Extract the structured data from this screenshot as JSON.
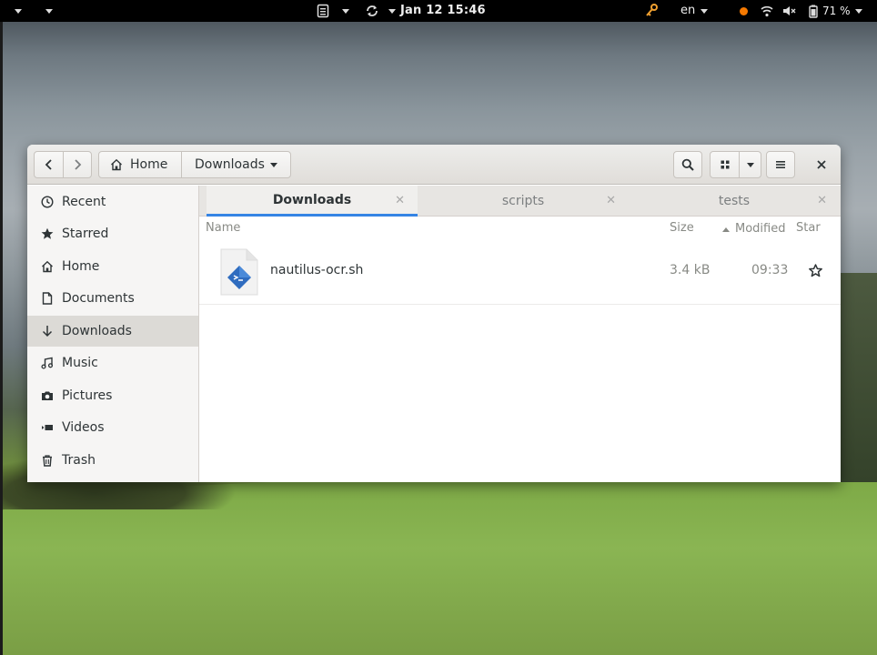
{
  "topbar": {
    "clock": "Jan 12  15:46",
    "language": "en",
    "battery": "71 %"
  },
  "window": {
    "path": {
      "home": "Home",
      "current": "Downloads"
    },
    "sidebar": {
      "items": [
        {
          "label": "Recent",
          "icon": "clock-icon"
        },
        {
          "label": "Starred",
          "icon": "star-icon"
        },
        {
          "label": "Home",
          "icon": "home-icon"
        },
        {
          "label": "Documents",
          "icon": "document-icon"
        },
        {
          "label": "Downloads",
          "icon": "download-icon",
          "active": true
        },
        {
          "label": "Music",
          "icon": "music-icon"
        },
        {
          "label": "Pictures",
          "icon": "camera-icon"
        },
        {
          "label": "Videos",
          "icon": "video-icon"
        },
        {
          "label": "Trash",
          "icon": "trash-icon"
        }
      ]
    },
    "tabs": [
      {
        "label": "Downloads",
        "active": true
      },
      {
        "label": "scripts",
        "active": false
      },
      {
        "label": "tests",
        "active": false
      }
    ],
    "columns": {
      "name": "Name",
      "size": "Size",
      "modified": "Modified",
      "star": "Star"
    },
    "files": [
      {
        "name": "nautilus-ocr.sh",
        "size": "3.4 kB",
        "modified": "09:33",
        "starred": false
      }
    ]
  },
  "colors": {
    "accent": "#3584e4",
    "topbar": "#000000",
    "status_dot": "#f57900"
  }
}
